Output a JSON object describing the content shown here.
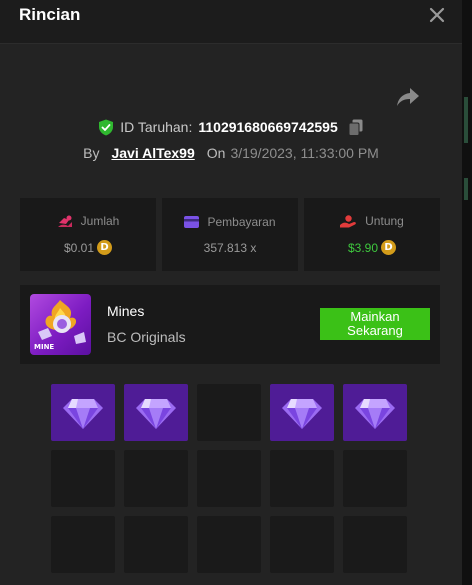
{
  "header": {
    "title": "Rincian",
    "close_icon": "close-icon"
  },
  "bet": {
    "id_label": "ID Taruhan:",
    "id_value": "110291680669742595",
    "by_label": "By",
    "user": "Javi AlTex99",
    "on_label": "On",
    "date": "3/19/2023, 11:33:00 PM"
  },
  "stats": [
    {
      "label": "Jumlah",
      "value": "$0.01",
      "icon": "coins-icon",
      "icon_color": "#e0336b",
      "coin": true,
      "highlight": false
    },
    {
      "label": "Pembayaran",
      "value": "357.813 x",
      "icon": "payout-card-icon",
      "icon_color": "#7a52e6",
      "coin": false,
      "highlight": false
    },
    {
      "label": "Untung",
      "value": "$3.90",
      "icon": "profit-hand-icon",
      "icon_color": "#e23b3b",
      "coin": true,
      "highlight": true
    }
  ],
  "coin_symbol": "D",
  "game": {
    "name": "Mines",
    "provider": "BC Originals",
    "thumb_label": "MINE",
    "play_label": "Mainkan\nSekarang"
  },
  "board": {
    "rows": 3,
    "cols": 5,
    "visible_rows": 3,
    "tiles": [
      "gem",
      "gem",
      "empty",
      "gem",
      "gem",
      "empty",
      "empty",
      "empty",
      "empty",
      "empty",
      "empty",
      "empty",
      "empty",
      "empty",
      "empty"
    ]
  },
  "colors": {
    "accent_green": "#3bc117",
    "gem_tile": "#4f1c96",
    "empty_tile": "#1a1a1a",
    "profit_text": "#3ec93e"
  }
}
